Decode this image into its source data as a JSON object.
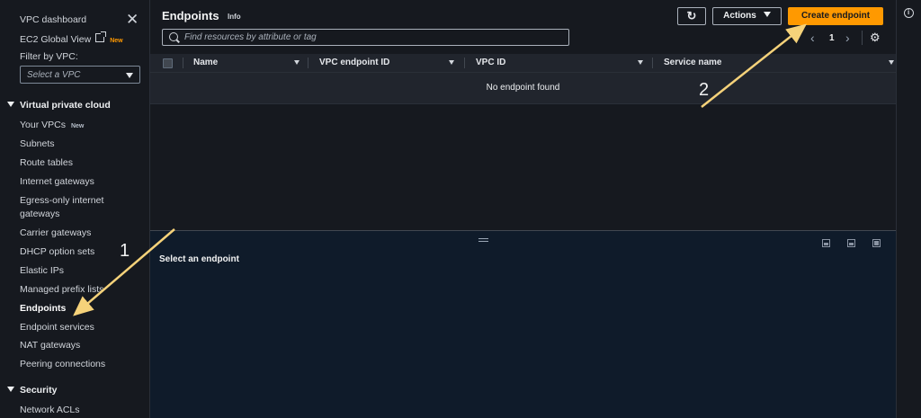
{
  "sidebar": {
    "vpc_dashboard": "VPC dashboard",
    "ec2_global_view": "EC2 Global View",
    "ec2_global_view_badge": "New",
    "filter_label": "Filter by VPC:",
    "filter_placeholder": "Select a VPC",
    "section_vpc": "Virtual private cloud",
    "items": [
      {
        "label": "Your VPCs",
        "badge": "New"
      },
      {
        "label": "Subnets"
      },
      {
        "label": "Route tables"
      },
      {
        "label": "Internet gateways"
      },
      {
        "label": "Egress-only internet"
      },
      {
        "label": "gateways"
      },
      {
        "label": "Carrier gateways"
      },
      {
        "label": "DHCP option sets"
      },
      {
        "label": "Elastic IPs"
      },
      {
        "label": "Managed prefix lists"
      },
      {
        "label": "Endpoints"
      },
      {
        "label": "Endpoint services"
      },
      {
        "label": "NAT gateways"
      },
      {
        "label": "Peering connections"
      }
    ],
    "section_security": "Security",
    "security_items": [
      {
        "label": "Network ACLs"
      }
    ]
  },
  "header": {
    "title": "Endpoints",
    "info": "Info",
    "refresh_icon": "refresh-icon",
    "actions_label": "Actions",
    "create_label": "Create endpoint"
  },
  "search": {
    "placeholder": "Find resources by attribute or tag"
  },
  "pagination": {
    "page": "1"
  },
  "table": {
    "columns": [
      "Name",
      "VPC endpoint ID",
      "VPC ID",
      "Service name"
    ],
    "empty_message": "No endpoint found"
  },
  "detail": {
    "title": "Select an endpoint"
  },
  "annotations": {
    "step1": "1",
    "step2": "2"
  },
  "colors": {
    "accent": "#ff9900",
    "annotation_arrow": "#f5d27a"
  }
}
